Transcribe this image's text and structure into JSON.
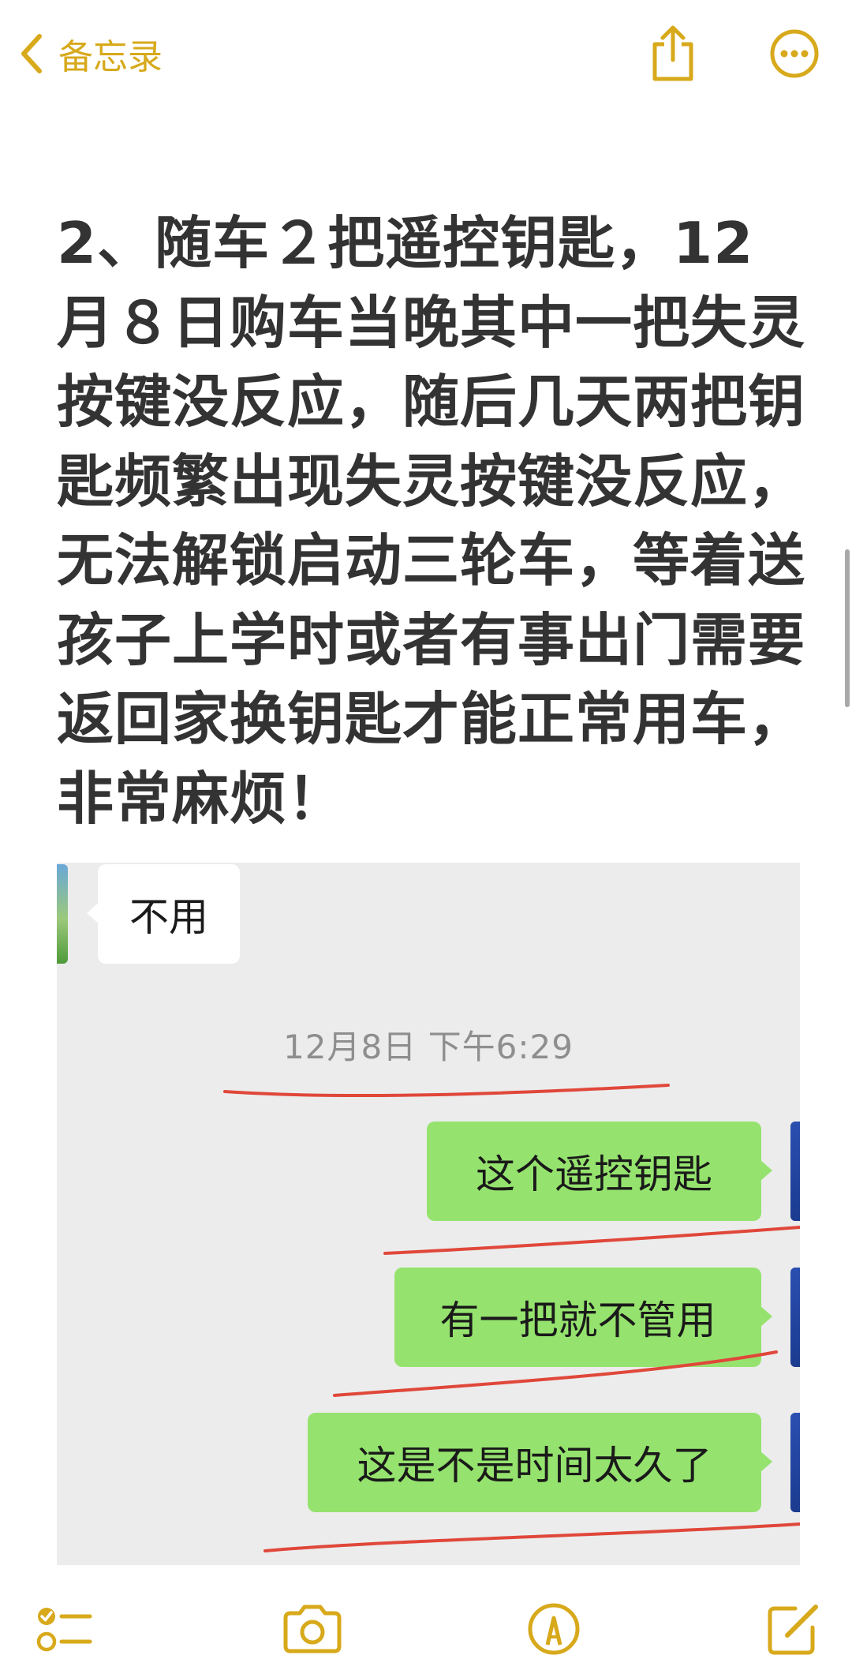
{
  "nav": {
    "back_label": "备忘录",
    "icons": [
      "chevron-left-icon",
      "share-icon",
      "more-icon"
    ]
  },
  "note": {
    "body": "2、随车２把遥控钥匙，12月８日购车当晚其中一把失灵按键没反应，随后几天两把钥匙频繁出现失灵按键没反应，无法解锁启动三轮车，等着送孩子上学时或者有事出门需要返回家换钥匙才能正常用车，非常麻烦！"
  },
  "chat": {
    "messages_left": [
      {
        "text": "不用"
      }
    ],
    "timestamp": "12月8日 下午6:29",
    "messages_right": [
      {
        "text": "这个遥控钥匙"
      },
      {
        "text": "有一把就不管用"
      },
      {
        "text": "这是不是时间太久了"
      }
    ]
  },
  "toolbar": {
    "icons": [
      "checklist-icon",
      "camera-icon",
      "markup-pen-icon",
      "compose-icon"
    ]
  },
  "colors": {
    "accent": "#d7a91b",
    "text": "#333333",
    "chat_bg": "#ececec",
    "bubble_green": "#95e36e",
    "annotation_red": "#e0473a"
  }
}
